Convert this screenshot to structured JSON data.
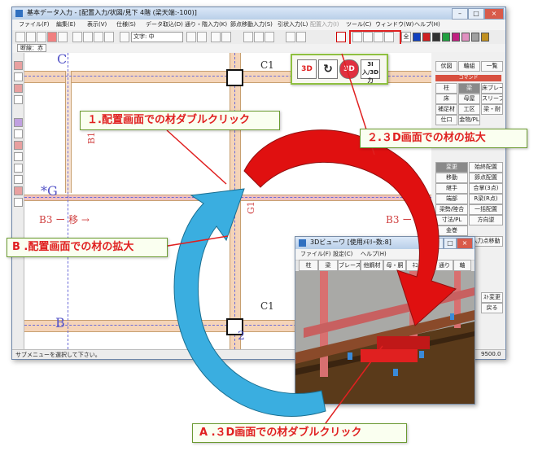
{
  "main_window": {
    "title": "基本データ入力 - [配置入力/状図/見下 4階 (梁天端:-100)]",
    "menus": [
      "ファイル(F)",
      "編集(E)",
      "表示(V)",
      "仕様(S)",
      "データ取込(D)",
      "通り・階入力(K)",
      "節点移動入力(S)",
      "引状入力(L)",
      "配置入力(I)",
      "ツール(C)",
      "ウィンドウ(W)",
      "ヘルプ(H)"
    ],
    "toolbar_font": "文字: 中",
    "toolbar_panel_right": "全",
    "sub_tab": "断線：赤",
    "status": "サブメニューを選択して下さい。",
    "status_right": "9500.0"
  },
  "palette": [
    "#1040c0",
    "#d02020",
    "#303030",
    "#20a040",
    "#c02080",
    "#e090c0",
    "#a0a0a0",
    "#c09020"
  ],
  "canvas": {
    "grid_labels": {
      "c_top": "C",
      "c1_top": "C1",
      "b1": "B1",
      "g_left": "*G",
      "b3_left": "B3 ー 移 →",
      "b3_right": "B3 ー →",
      "g1": "G1",
      "c1_bottom": "C1",
      "b_bottom": "B",
      "num_2": "2"
    }
  },
  "right_panel": {
    "tabs": [
      "伏図",
      "軸組",
      "一覧"
    ],
    "header": "コマンド",
    "rows": [
      [
        "柱",
        "梁",
        "床ブレース"
      ],
      [
        "床",
        "母屋",
        "スリーブ"
      ],
      [
        "補足材",
        "工区",
        "梁・耐"
      ],
      [
        "仕口",
        "金物/PL",
        ""
      ]
    ],
    "commands_left": [
      "変更",
      "移動",
      "継手",
      "端部",
      "梁勢/陸合",
      "寸法/PL",
      "金巻"
    ],
    "commands_right": [
      "始終配置",
      "節点配置",
      "合掌(3点)",
      "R梁(R点)",
      "一括配置",
      "方向逆",
      "",
      "入力点移動"
    ],
    "bottom": [
      "ｽﾄ変更",
      "戻る"
    ]
  },
  "viewer": {
    "title": "3Dビューワ [使用ﾒﾓﾘｰ数:8]",
    "menus": [
      "ファイル(F)",
      "設定(C)",
      "ヘルプ(H)"
    ],
    "tabs": [
      "柱",
      "梁",
      "ブレース",
      "他鋼材",
      "母・胴",
      "ﾈｺ",
      "通り",
      "軸"
    ]
  },
  "popup_icons": [
    "3D",
    "↻",
    "3D",
    "3I入/3D力"
  ],
  "callouts": {
    "step1": "１.配置画面での材ダブルクリック",
    "step2": "２.３D画面での材の拡大",
    "stepB": "B .配置画面での材の拡大",
    "stepA": "A .３D画面での材ダブルクリック"
  },
  "colors": {
    "arrow_red": "#e01010",
    "arrow_blue": "#3aaee0",
    "callout_border": "#6a9a30",
    "grid": "#6a6ad8",
    "beam": "#f5d4b8"
  }
}
